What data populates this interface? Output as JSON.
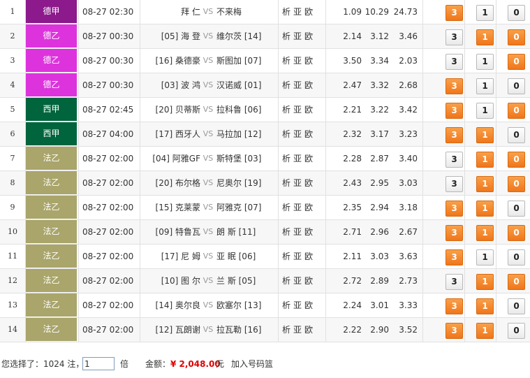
{
  "colors": {
    "德甲": "#8c1a8c",
    "德乙": "#dd33dd",
    "西甲": "#00643c",
    "法乙": "#a9a56b",
    "selected": "#f5821f"
  },
  "analysis_links": [
    "析",
    "亚",
    "欧"
  ],
  "vs_label": "VS",
  "matches": [
    {
      "num": "1",
      "league": "德甲",
      "time": "08-27 02:30",
      "home": "拜 仁",
      "away": "不来梅",
      "o1": "1.09",
      "o2": "10.29",
      "o3": "24.73",
      "picks": [
        "3",
        "1",
        "0"
      ],
      "sel": [
        true,
        false,
        false
      ]
    },
    {
      "num": "2",
      "league": "德乙",
      "time": "08-27 00:30",
      "home": "[05] 海 登",
      "away": "维尔茨 [14]",
      "o1": "2.14",
      "o2": "3.12",
      "o3": "3.46",
      "picks": [
        "3",
        "1",
        "0"
      ],
      "sel": [
        false,
        true,
        true
      ]
    },
    {
      "num": "3",
      "league": "德乙",
      "time": "08-27 00:30",
      "home": "[16] 桑德豪",
      "away": "斯图加 [07]",
      "o1": "3.50",
      "o2": "3.34",
      "o3": "2.03",
      "picks": [
        "3",
        "1",
        "0"
      ],
      "sel": [
        false,
        false,
        true
      ]
    },
    {
      "num": "4",
      "league": "德乙",
      "time": "08-27 00:30",
      "home": "[03] 波 鸿",
      "away": "汉诺威 [01]",
      "o1": "2.47",
      "o2": "3.32",
      "o3": "2.68",
      "picks": [
        "3",
        "1",
        "0"
      ],
      "sel": [
        true,
        false,
        false
      ]
    },
    {
      "num": "5",
      "league": "西甲",
      "time": "08-27 02:45",
      "home": "[20] 贝蒂斯",
      "away": "拉科鲁 [06]",
      "o1": "2.21",
      "o2": "3.22",
      "o3": "3.42",
      "picks": [
        "3",
        "1",
        "0"
      ],
      "sel": [
        true,
        false,
        true
      ]
    },
    {
      "num": "6",
      "league": "西甲",
      "time": "08-27 04:00",
      "home": "[17] 西牙人",
      "away": "马拉加 [12]",
      "o1": "2.32",
      "o2": "3.17",
      "o3": "3.23",
      "picks": [
        "3",
        "1",
        "0"
      ],
      "sel": [
        true,
        true,
        false
      ]
    },
    {
      "num": "7",
      "league": "法乙",
      "time": "08-27 02:00",
      "home": "[04] 阿雅GF",
      "away": "斯特堡 [03]",
      "o1": "2.28",
      "o2": "2.87",
      "o3": "3.40",
      "picks": [
        "3",
        "1",
        "0"
      ],
      "sel": [
        false,
        true,
        true
      ]
    },
    {
      "num": "8",
      "league": "法乙",
      "time": "08-27 02:00",
      "home": "[20] 布尔格",
      "away": "尼奥尔 [19]",
      "o1": "2.43",
      "o2": "2.95",
      "o3": "3.03",
      "picks": [
        "3",
        "1",
        "0"
      ],
      "sel": [
        false,
        true,
        true
      ]
    },
    {
      "num": "9",
      "league": "法乙",
      "time": "08-27 02:00",
      "home": "[15] 克莱蒙",
      "away": "阿雅克 [07]",
      "o1": "2.35",
      "o2": "2.94",
      "o3": "3.18",
      "picks": [
        "3",
        "1",
        "0"
      ],
      "sel": [
        true,
        true,
        false
      ]
    },
    {
      "num": "10",
      "league": "法乙",
      "time": "08-27 02:00",
      "home": "[09] 特鲁瓦",
      "away": "朗 斯 [11]",
      "o1": "2.71",
      "o2": "2.96",
      "o3": "2.67",
      "picks": [
        "3",
        "1",
        "0"
      ],
      "sel": [
        true,
        true,
        true
      ]
    },
    {
      "num": "11",
      "league": "法乙",
      "time": "08-27 02:00",
      "home": "[17] 尼 姆",
      "away": "亚 眠 [06]",
      "o1": "2.11",
      "o2": "3.03",
      "o3": "3.63",
      "picks": [
        "3",
        "1",
        "0"
      ],
      "sel": [
        true,
        false,
        false
      ]
    },
    {
      "num": "12",
      "league": "法乙",
      "time": "08-27 02:00",
      "home": "[10] 图 尔",
      "away": "兰 斯 [05]",
      "o1": "2.72",
      "o2": "2.89",
      "o3": "2.73",
      "picks": [
        "3",
        "1",
        "0"
      ],
      "sel": [
        false,
        true,
        true
      ]
    },
    {
      "num": "13",
      "league": "法乙",
      "time": "08-27 02:00",
      "home": "[14] 奥尔良",
      "away": "欧塞尔 [13]",
      "o1": "2.24",
      "o2": "3.01",
      "o3": "3.33",
      "picks": [
        "3",
        "1",
        "0"
      ],
      "sel": [
        true,
        true,
        false
      ]
    },
    {
      "num": "14",
      "league": "法乙",
      "time": "08-27 02:00",
      "home": "[12] 瓦朗谢",
      "away": "拉瓦勒 [16]",
      "o1": "2.22",
      "o2": "2.90",
      "o3": "3.52",
      "picks": [
        "3",
        "1",
        "0"
      ],
      "sel": [
        true,
        true,
        false
      ]
    }
  ],
  "footer": {
    "selected_label": "您选择了：1024 注，",
    "multiplier_value": "1",
    "multiplier_unit": "倍",
    "amount_label": "金额：",
    "amount_value": "¥ 2,048.00",
    "amount_unit": "元",
    "add_basket": "加入号码篮"
  }
}
